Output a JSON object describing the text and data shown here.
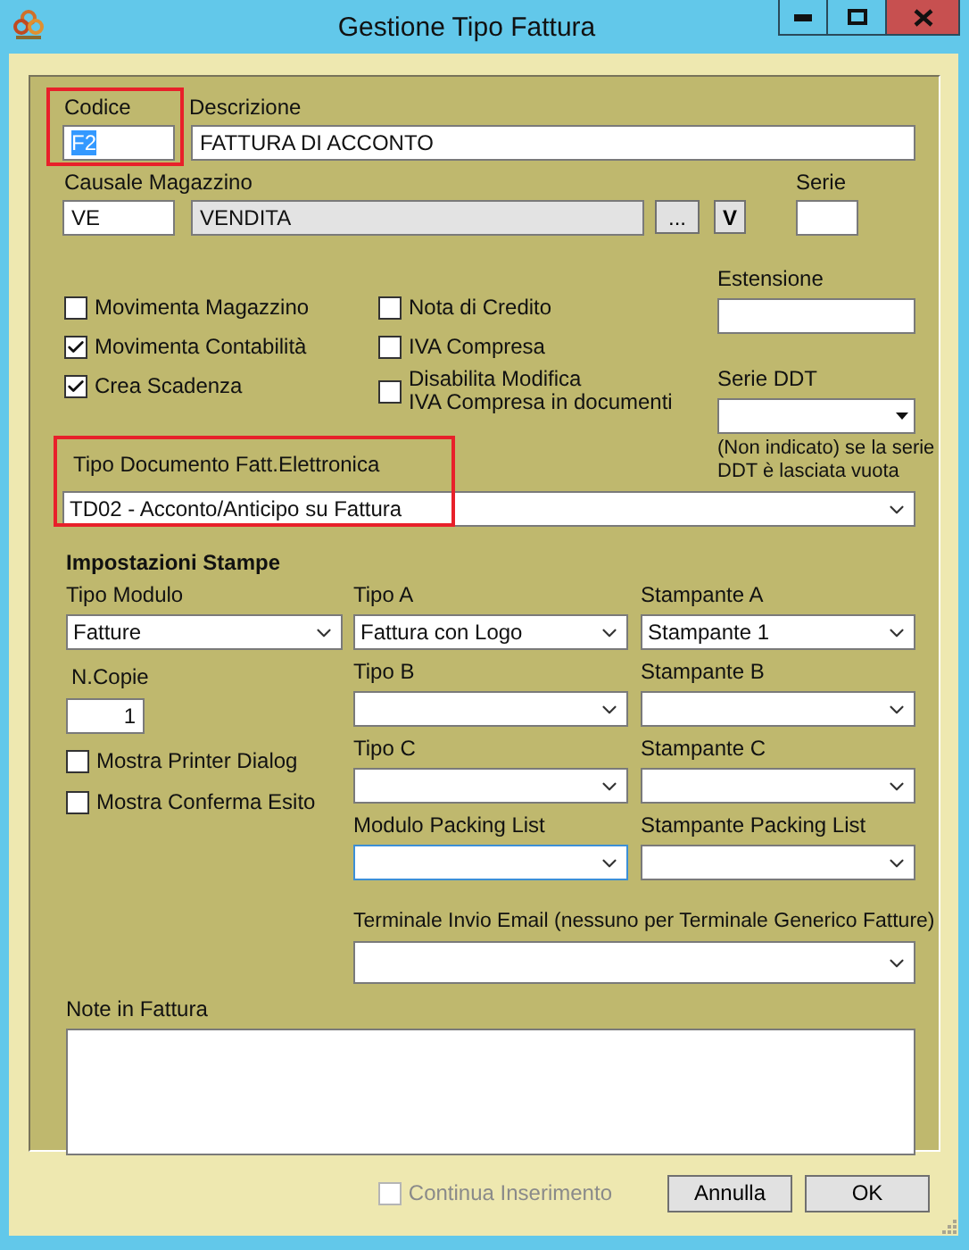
{
  "window": {
    "title": "Gestione Tipo Fattura"
  },
  "codice": {
    "label": "Codice",
    "value": "F2",
    "text_selected": true,
    "highlighted": true
  },
  "descrizione": {
    "label": "Descrizione",
    "value": "FATTURA DI ACCONTO"
  },
  "causale_magazzino": {
    "label": "Causale Magazzino",
    "code": "VE",
    "description": "VENDITA",
    "browse_button": "...",
    "v_button": "V"
  },
  "serie": {
    "label": "Serie"
  },
  "checks_left": [
    {
      "label": "Movimenta Magazzino",
      "checked": false
    },
    {
      "label": "Movimenta Contabilità",
      "checked": true
    },
    {
      "label": "Crea Scadenza",
      "checked": true
    }
  ],
  "checks_right": [
    {
      "label": "Nota di Credito",
      "checked": false
    },
    {
      "label": "IVA Compresa",
      "checked": false
    },
    {
      "label": "Disabilita Modifica\nIVA Compresa in documenti",
      "checked": false
    }
  ],
  "estensione": {
    "label": "Estensione"
  },
  "serie_ddt": {
    "label": "Serie DDT",
    "note": "(Non indicato) se la serie\nDDT è lasciata vuota"
  },
  "tipo_documento": {
    "label": "Tipo Documento Fatt.Elettronica",
    "value": "TD02 - Acconto/Anticipo su Fattura",
    "highlighted": true
  },
  "stampe": {
    "title": "Impostazioni Stampe",
    "tipo_modulo": {
      "label": "Tipo Modulo",
      "value": "Fatture"
    },
    "n_copie": {
      "label": "N.Copie",
      "value": "1"
    },
    "options": [
      {
        "label": "Mostra Printer Dialog",
        "checked": false
      },
      {
        "label": "Mostra Conferma Esito",
        "checked": false
      }
    ],
    "tipi": [
      {
        "label": "Tipo A",
        "value": "Fattura con Logo",
        "focused": false
      },
      {
        "label": "Tipo B",
        "focused": false
      },
      {
        "label": "Tipo C",
        "focused": false
      },
      {
        "label": "Modulo Packing List",
        "focused": true
      }
    ],
    "stampanti": [
      {
        "label": "Stampante A",
        "value": "Stampante 1",
        "focused": false
      },
      {
        "label": "Stampante B",
        "focused": false
      },
      {
        "label": "Stampante C",
        "focused": false
      },
      {
        "label": "Stampante Packing List",
        "focused": false
      }
    ],
    "terminale": {
      "label": "Terminale Invio Email (nessuno per Terminale Generico Fatture)"
    }
  },
  "note": {
    "label": "Note in Fattura"
  },
  "footer": {
    "continua": {
      "label": "Continua Inserimento",
      "checked": false,
      "disabled": true
    },
    "buttons": [
      "Annulla",
      "OK"
    ]
  }
}
